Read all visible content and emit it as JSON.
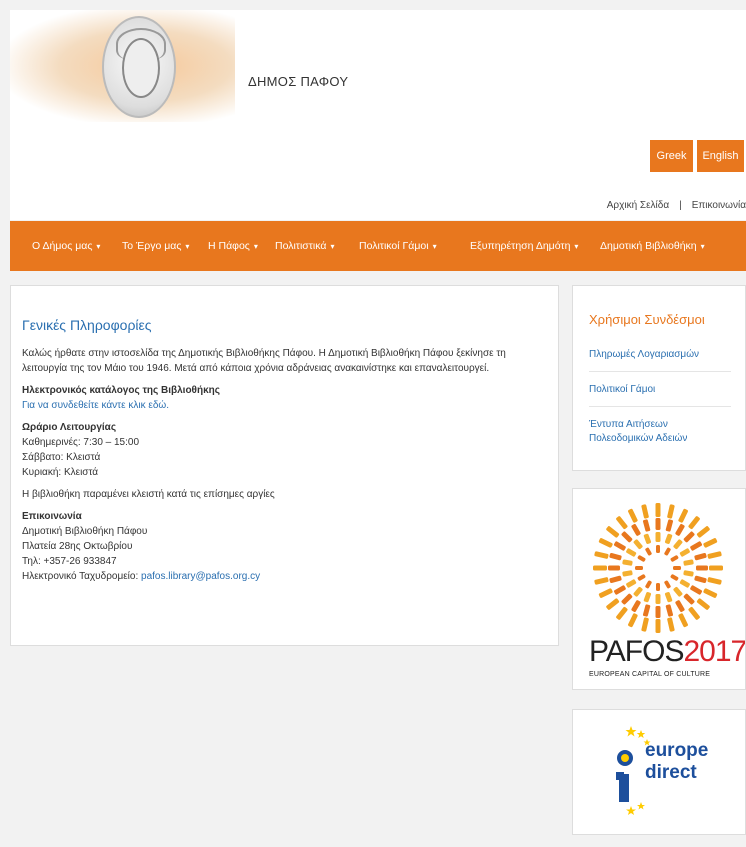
{
  "header": {
    "site_title": "ΔΗΜΟΣ ΠΑΦΟΥ",
    "lang_greek": "Greek",
    "lang_english": "English",
    "toplinks": {
      "home": "Αρχική Σελίδα",
      "separator": "|",
      "contact": "Επικοινωνία"
    }
  },
  "nav": [
    {
      "label": "Ο Δήμος μας",
      "caret": "▾"
    },
    {
      "label": "Το Έργο μας",
      "caret": "▾"
    },
    {
      "label": "Η Πάφος",
      "caret": "▾"
    },
    {
      "label": "Πολιτιστικά",
      "caret": "▾"
    },
    {
      "label": "Πολιτικοί Γάμοι",
      "caret": "▾"
    },
    {
      "label": "Εξυπηρέτηση Δημότη",
      "caret": "▾"
    },
    {
      "label": "Δημοτική Βιβλιοθήκη",
      "caret": "▾"
    }
  ],
  "main": {
    "title": "Γενικές Πληροφορίες",
    "intro": "Καλώς ήρθατε στην ιστοσελίδα της Δημοτικής Βιβλιοθήκης Πάφου. Η Δημοτική Βιβλιοθήκη Πάφου ξεκίνησε τη λειτουργία της τον Μάιο του 1946. Μετά από κάποια χρόνια αδράνειας ανακαινίστηκε και επαναλειτουργεί.",
    "catalog_heading": "Ηλεκτρονικός κατάλογος της Βιβλιοθήκης",
    "catalog_link": "Για να συνδεθείτε κάντε κλικ εδώ.",
    "hours_heading": "Ωράριο Λειτουργίας",
    "hours_weekdays": "Καθημερινές: 7:30 – 15:00",
    "hours_saturday": "Σάββατο: Κλειστά",
    "hours_sunday": "Κυριακή: Κλειστά",
    "holidays_note": "Η βιβλιοθήκη παραμένει κλειστή κατά τις επίσημες αργίες",
    "contact_heading": "Επικοινωνία",
    "contact_name": "Δημοτική Βιβλιοθήκη Πάφου",
    "contact_address": "Πλατεία 28ης Οκτωβρίου",
    "contact_phone": "Τηλ: +357-26 933847",
    "contact_email_label": "Ηλεκτρονικό Ταχυδρομείο: ",
    "contact_email": "pafos.library@pafos.org.cy"
  },
  "sidebar": {
    "title": "Χρήσιμοι Συνδέσμοι",
    "links": [
      {
        "label": "Πληρωμές Λογαριασμών"
      },
      {
        "label": "Πολιτικοί Γάμοι"
      },
      {
        "label": "Έντυπα Αιτήσεων Πολεοδομικών Αδειών"
      }
    ],
    "pafos_banner": {
      "text_main": "PAFOS",
      "text_year": "2017",
      "subtitle": "EUROPEAN CAPITAL OF CULTURE"
    },
    "eu_banner": {
      "word1": "europe",
      "word2": "direct"
    }
  },
  "colors": {
    "accent": "#e8771e",
    "link": "#2a6fb0",
    "pafos_red": "#d8262b",
    "eu_blue": "#1d4f9c",
    "eu_yellow": "#ffcc00"
  }
}
